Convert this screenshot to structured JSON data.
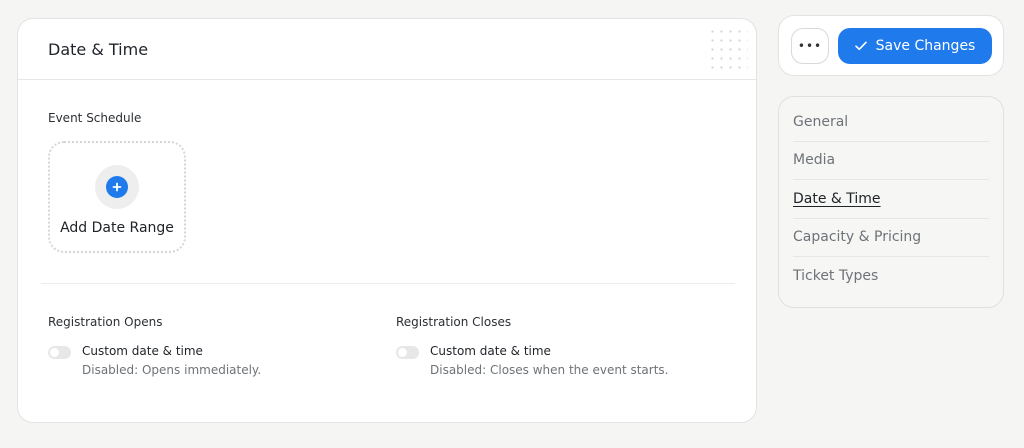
{
  "card": {
    "title": "Date & Time"
  },
  "schedule": {
    "label": "Event Schedule",
    "add_label": "Add Date Range"
  },
  "registration": {
    "opens": {
      "title": "Registration Opens",
      "option": "Custom date & time",
      "sub": "Disabled: Opens immediately.",
      "enabled": false
    },
    "closes": {
      "title": "Registration Closes",
      "option": "Custom date & time",
      "sub": "Disabled: Closes when the event starts.",
      "enabled": false
    }
  },
  "actions": {
    "more_label": "•••",
    "save_label": "Save Changes"
  },
  "nav": {
    "items": [
      {
        "label": "General",
        "active": false
      },
      {
        "label": "Media",
        "active": false
      },
      {
        "label": "Date & Time",
        "active": true
      },
      {
        "label": "Capacity & Pricing",
        "active": false
      },
      {
        "label": "Ticket Types",
        "active": false
      }
    ]
  },
  "colors": {
    "accent": "#1f7aec",
    "background": "#f5f5f4",
    "muted_text": "#6e7378"
  },
  "icons": {
    "add": "plus-icon",
    "save": "check-icon",
    "more": "ellipsis-icon"
  }
}
